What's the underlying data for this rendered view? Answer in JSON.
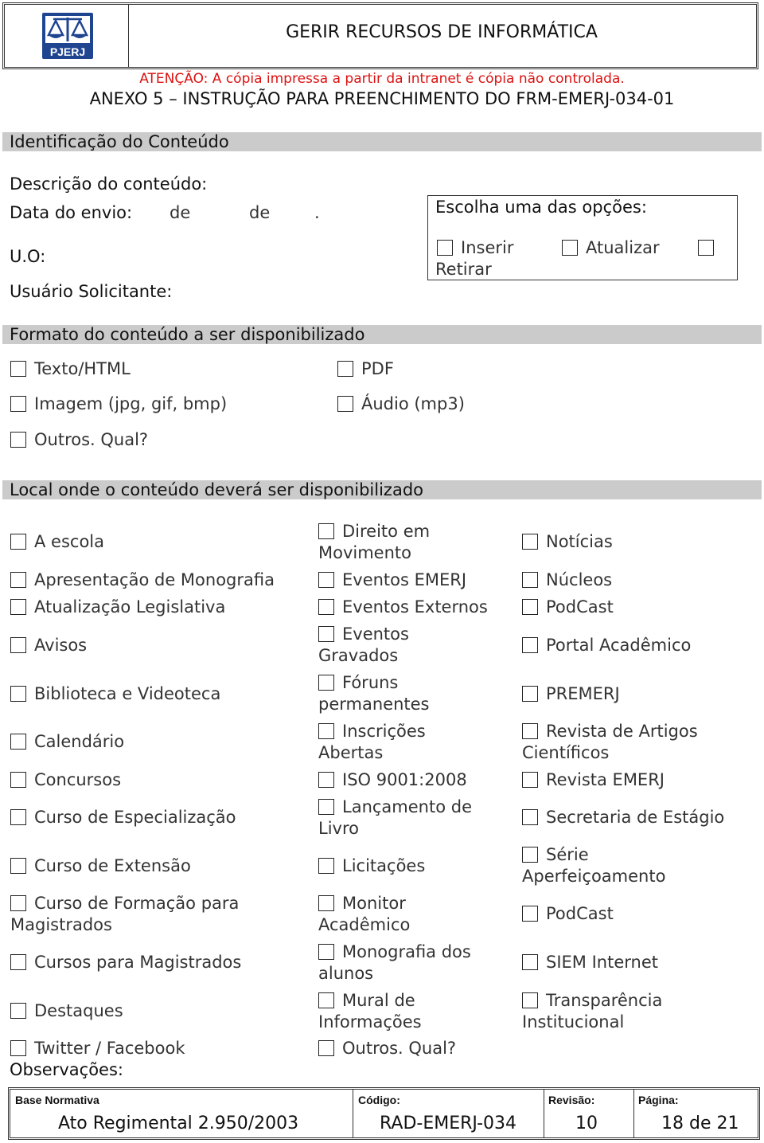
{
  "header": {
    "logo_text": "PJERJ",
    "title": "GERIR RECURSOS DE INFORMÁTICA",
    "warning": "ATENÇÃO: A cópia impressa a partir da intranet é cópia não controlada.",
    "annex": "ANEXO 5 – INSTRUÇÃO PARA PREENCHIMENTO DO FRM-EMERJ-034-01",
    "colors": {
      "logo_blue": "#1f4591",
      "warning_red": "#dd1111",
      "section_gray": "#cbcbcb"
    }
  },
  "identification": {
    "section_title": "Identificação do Conteúdo",
    "description_label": "Descrição do conteúdo:",
    "date_label": "Data do envio:",
    "date_de1": "de",
    "date_de2": "de",
    "date_dot": ".",
    "uo_label": "U.O:",
    "user_label": "Usuário Solicitante:",
    "options_title": "Escolha uma das opções:",
    "options": [
      {
        "label": "Inserir",
        "checked": false
      },
      {
        "label": "Atualizar",
        "checked": false
      },
      {
        "label": "Retirar",
        "checked": false
      }
    ]
  },
  "format": {
    "section_title": "Formato do conteúdo a ser disponibilizado",
    "items": [
      {
        "label": "Texto/HTML",
        "checked": false
      },
      {
        "label": "PDF",
        "checked": false
      },
      {
        "label": "Imagem (jpg, gif, bmp)",
        "checked": false
      },
      {
        "label": "Áudio (mp3)",
        "checked": false
      },
      {
        "label": "Outros. Qual?",
        "checked": false
      }
    ]
  },
  "location": {
    "section_title": "Local onde o conteúdo deverá ser disponibilizado",
    "col1": [
      "A escola",
      "Apresentação de Monografia",
      "Atualização Legislativa",
      "Avisos",
      "Biblioteca e Videoteca",
      "Calendário",
      "Concursos",
      "Curso de Especialização",
      "Curso de Extensão",
      "Curso de Formação para Magistrados",
      "Cursos para Magistrados",
      "Destaques",
      "Twitter / Facebook"
    ],
    "col2": [
      "Direito em Movimento",
      "Eventos EMERJ",
      "Eventos Externos",
      "Eventos Gravados",
      "Fóruns permanentes",
      "Inscrições Abertas",
      "ISO 9001:2008",
      "Lançamento de Livro",
      "Licitações",
      "Monitor Acadêmico",
      "Monografia dos alunos",
      "Mural de Informações",
      "Outros. Qual?"
    ],
    "col3": [
      "Notícias",
      "Núcleos",
      "PodCast",
      "Portal Acadêmico",
      "PREMERJ",
      "Revista de Artigos Científicos",
      "Revista EMERJ",
      "Secretaria de Estágio",
      "Série Aperfeiçoamento",
      "PodCast",
      "SIEM Internet",
      "Transparência Institucional"
    ]
  },
  "observations_label": "Observações:",
  "footer": {
    "base_label": "Base Normativa",
    "base_value": "Ato Regimental 2.950/2003",
    "code_label": "Código:",
    "code_value": "RAD-EMERJ-034",
    "revision_label": "Revisão:",
    "revision_value": "10",
    "page_label": "Página:",
    "page_value": "18 de 21"
  }
}
